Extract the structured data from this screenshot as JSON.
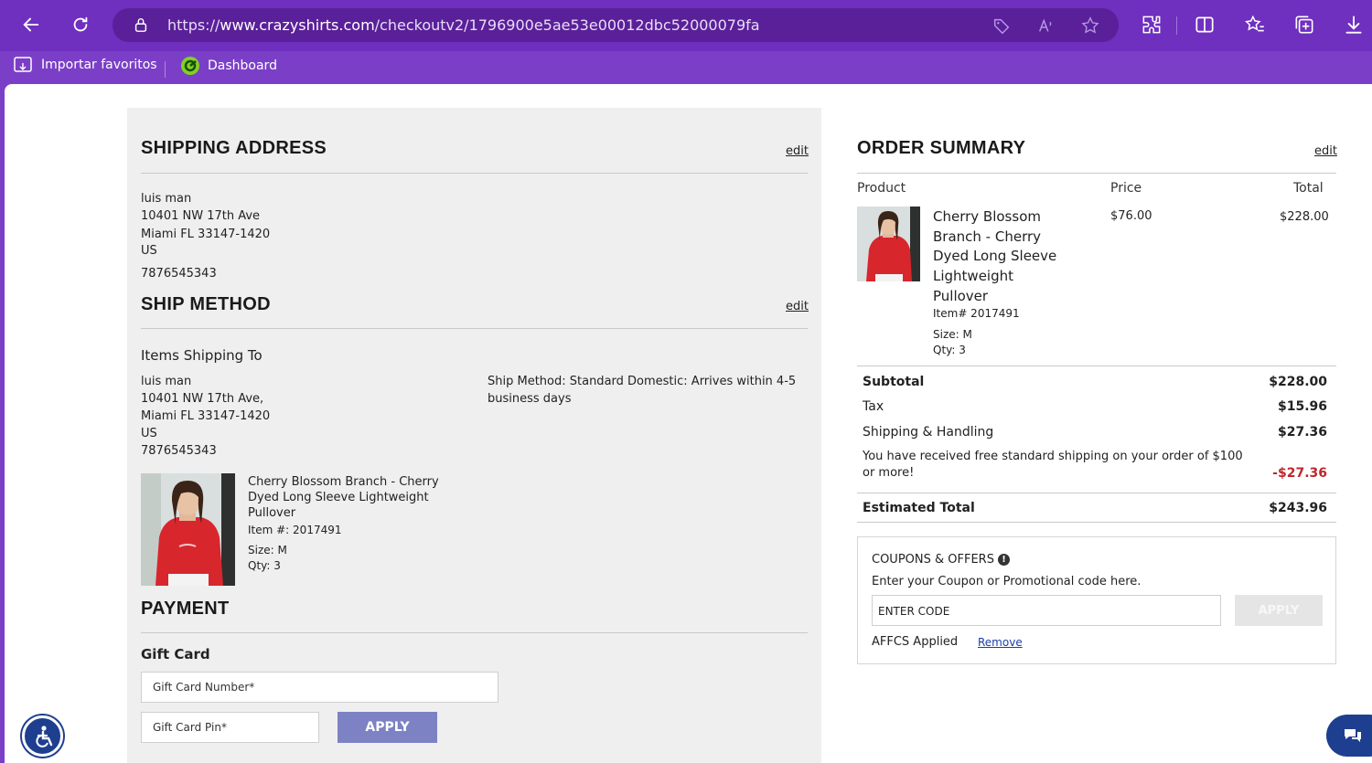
{
  "browser": {
    "url_prefix": "https://",
    "url_host": "www.crazyshirts.com",
    "url_path": "/checkoutv2/1796900e5ae53e00012dbc52000079fa",
    "bookmarks": [
      "Importar favoritos",
      "Dashboard"
    ]
  },
  "left": {
    "shipping_address": {
      "title": "SHIPPING ADDRESS",
      "edit": "edit",
      "name": "luis man",
      "street": "10401 NW 17th Ave",
      "city": "Miami FL 33147-1420",
      "country": "US",
      "phone": "7876545343"
    },
    "ship_method": {
      "title": "SHIP METHOD",
      "edit": "edit",
      "subtitle": "Items Shipping To",
      "name": "luis man",
      "street": "10401 NW 17th Ave,",
      "city": "Miami FL 33147-1420",
      "country": "US",
      "phone": "7876545343",
      "method_line1": "Ship Method: Standard Domestic: Arrives within 4-5",
      "method_line2": "business days",
      "item": {
        "name_l1": "Cherry Blossom Branch - Cherry",
        "name_l2": "Dyed Long Sleeve Lightweight",
        "name_l3": "Pullover",
        "item_no": "Item #: 2017491",
        "size": "Size: M",
        "qty": "Qty: 3"
      }
    },
    "payment": {
      "title": "PAYMENT",
      "gift_card_title": "Gift Card",
      "gift_card_number_placeholder": "Gift Card Number*",
      "gift_card_pin_placeholder": "Gift Card Pin*",
      "apply": "APPLY"
    }
  },
  "summary": {
    "title": "ORDER SUMMARY",
    "edit": "edit",
    "col_product": "Product",
    "col_price": "Price",
    "col_total": "Total",
    "product": {
      "name_l1": "Cherry Blossom",
      "name_l2": "Branch - Cherry",
      "name_l3": "Dyed Long Sleeve",
      "name_l4": "Lightweight",
      "name_l5": "Pullover",
      "item_no": "Item# 2017491",
      "size": "Size: M",
      "qty": "Qty: 3",
      "price": "$76.00",
      "total": "$228.00"
    },
    "subtotal_label": "Subtotal",
    "subtotal": "$228.00",
    "tax_label": "Tax",
    "tax": "$15.96",
    "shipping_label": "Shipping & Handling",
    "shipping": "$27.36",
    "free_ship_l1": "You have received free standard shipping on your order of $100",
    "free_ship_l2": "or more!",
    "free_ship_discount": "-$27.36",
    "estimated_label": "Estimated Total",
    "estimated_total": "$243.96"
  },
  "coupons": {
    "title": "COUPONS & OFFERS",
    "instruction": "Enter your Coupon or Promotional code here.",
    "placeholder": "ENTER CODE",
    "apply": "APPLY",
    "applied_text": "AFFCS Applied",
    "remove": "Remove"
  },
  "colors": {
    "browser_purple": "#6f2fbf",
    "panel_gray": "#efefef",
    "apply_button": "#7d82c4",
    "discount_red": "#c0262b"
  }
}
